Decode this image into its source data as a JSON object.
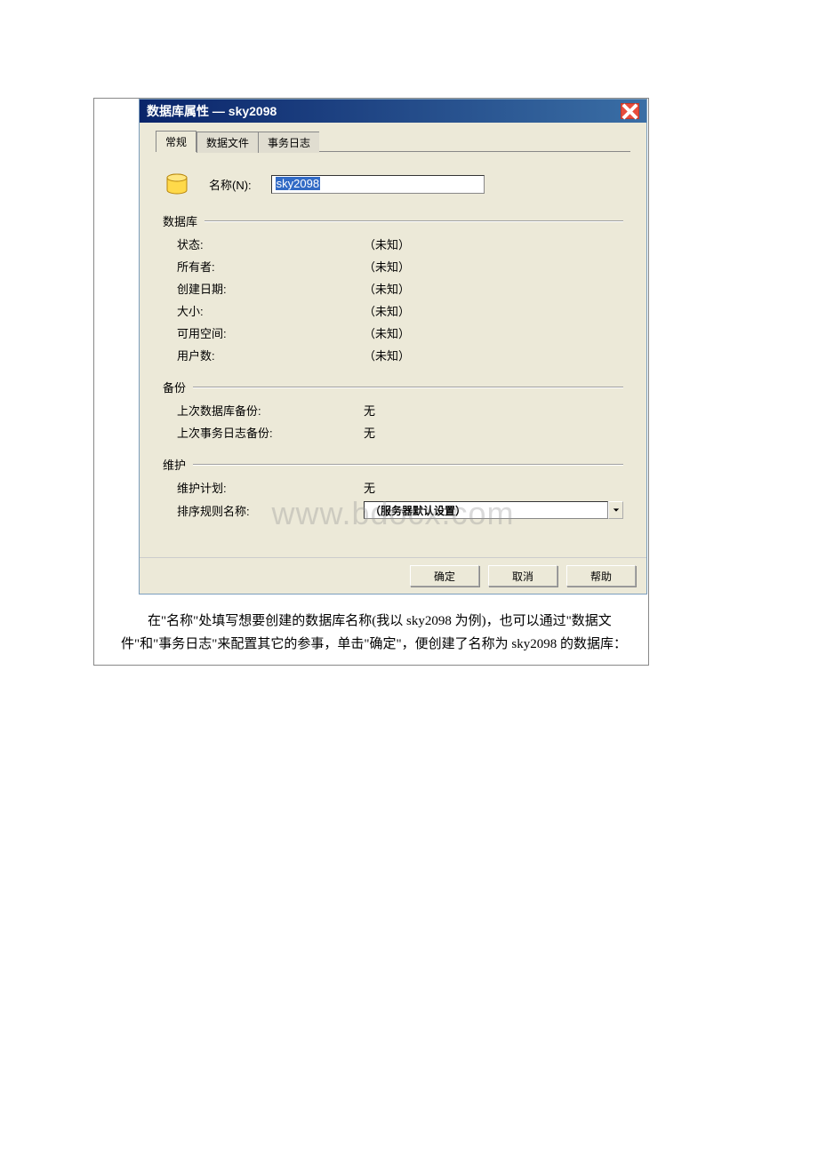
{
  "dialog": {
    "title": "数据库属性 — sky2098",
    "tabs": {
      "general": "常规",
      "datafile": "数据文件",
      "txlog": "事务日志"
    },
    "name_label": "名称(N):",
    "name_value": "sky2098",
    "group_db": "数据库",
    "db_fields": {
      "status_label": "状态:",
      "status_value": "（未知）",
      "owner_label": "所有者:",
      "owner_value": "（未知）",
      "created_label": "创建日期:",
      "created_value": "（未知）",
      "size_label": "大小:",
      "size_value": "（未知）",
      "free_label": "可用空间:",
      "free_value": "（未知）",
      "users_label": "用户数:",
      "users_value": "（未知）"
    },
    "group_backup": "备份",
    "backup_fields": {
      "lastdb_label": "上次数据库备份:",
      "lastdb_value": "无",
      "lastlog_label": "上次事务日志备份:",
      "lastlog_value": "无"
    },
    "group_maint": "维护",
    "maint_fields": {
      "plan_label": "维护计划:",
      "plan_value": "无",
      "collation_label": "排序规则名称:",
      "collation_value": "（服务器默认设置）"
    },
    "buttons": {
      "ok": "确定",
      "cancel": "取消",
      "help": "帮助"
    }
  },
  "watermark": "www.bdocx.com",
  "description": "　　在\"名称\"处填写想要创建的数据库名称(我以 sky2098 为例)，也可以通过\"数据文件\"和\"事务日志\"来配置其它的参事，单击\"确定\"，便创建了名称为 sky2098 的数据库："
}
